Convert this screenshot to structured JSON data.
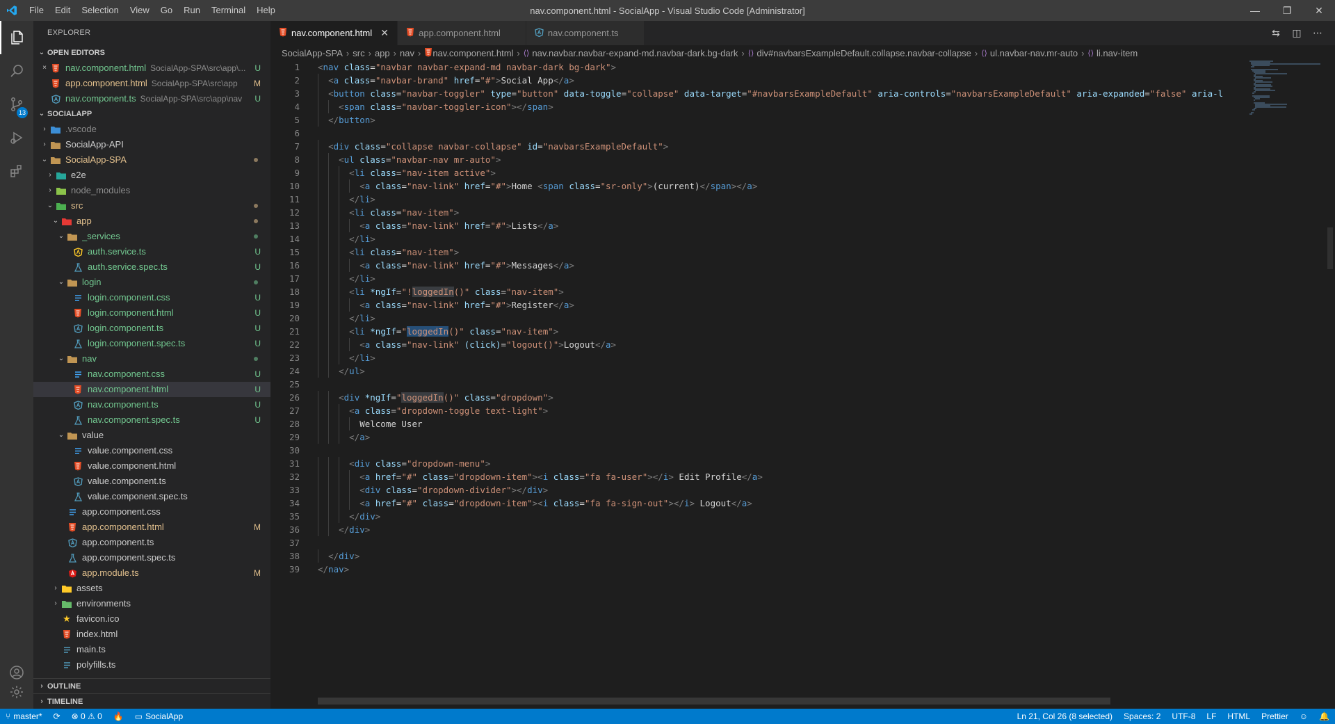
{
  "window": {
    "title": "nav.component.html - SocialApp - Visual Studio Code [Administrator]",
    "menu": [
      "File",
      "Edit",
      "Selection",
      "View",
      "Go",
      "Run",
      "Terminal",
      "Help"
    ],
    "controls": {
      "minimize": "—",
      "restore": "❐",
      "close": "✕"
    }
  },
  "activity_bar": {
    "items": [
      {
        "name": "explorer-icon",
        "glyph": "❐"
      },
      {
        "name": "search-icon",
        "glyph": "⌕"
      },
      {
        "name": "source-control-icon",
        "glyph": "⑂",
        "badge": "13"
      },
      {
        "name": "run-debug-icon",
        "glyph": "▷"
      },
      {
        "name": "extensions-icon",
        "glyph": "⊞"
      }
    ],
    "bottom": [
      {
        "name": "accounts-icon",
        "glyph": "◯"
      },
      {
        "name": "manage-gear-icon",
        "glyph": "⚙"
      }
    ]
  },
  "sidebar": {
    "title": "EXPLORER",
    "open_editors": {
      "heading": "OPEN EDITORS",
      "items": [
        {
          "close": "×",
          "icon": "html",
          "name": "nav.component.html",
          "path": "SocialApp-SPA\\src\\app\\...",
          "status": "U",
          "status_class": "c-untracked"
        },
        {
          "close": "",
          "icon": "html",
          "name": "app.component.html",
          "path": "SocialApp-SPA\\src\\app",
          "status": "M",
          "status_class": "c-modified"
        },
        {
          "close": "",
          "icon": "ts",
          "name": "nav.component.ts",
          "path": "SocialApp-SPA\\src\\app\\nav",
          "status": "U",
          "status_class": "c-untracked"
        }
      ]
    },
    "workspace": {
      "heading": "SOCIALAPP",
      "items": [
        {
          "depth": 0,
          "twist": "›",
          "icon": "folder-vscode",
          "name": ".vscode",
          "cls": "c-ignored",
          "deco": ""
        },
        {
          "depth": 0,
          "twist": "›",
          "icon": "folder",
          "name": "SocialApp-API",
          "cls": "",
          "deco": ""
        },
        {
          "depth": 0,
          "twist": "⌄",
          "icon": "folder",
          "name": "SocialApp-SPA",
          "cls": "c-modified",
          "deco": "dot-modified"
        },
        {
          "depth": 1,
          "twist": "›",
          "icon": "folder-e2e",
          "name": "e2e",
          "cls": "",
          "deco": ""
        },
        {
          "depth": 1,
          "twist": "›",
          "icon": "folder-node",
          "name": "node_modules",
          "cls": "c-ignored",
          "deco": ""
        },
        {
          "depth": 1,
          "twist": "⌄",
          "icon": "folder-src",
          "name": "src",
          "cls": "c-modified",
          "deco": "dot-modified"
        },
        {
          "depth": 2,
          "twist": "⌄",
          "icon": "folder-app",
          "name": "app",
          "cls": "c-modified",
          "deco": "dot-modified"
        },
        {
          "depth": 3,
          "twist": "⌄",
          "icon": "folder",
          "name": "_services",
          "cls": "c-untracked",
          "deco": "dot-untracked"
        },
        {
          "depth": 4,
          "twist": "",
          "icon": "ts-service",
          "name": "auth.service.ts",
          "cls": "c-untracked",
          "deco": "U"
        },
        {
          "depth": 4,
          "twist": "",
          "icon": "spec",
          "name": "auth.service.spec.ts",
          "cls": "c-untracked",
          "deco": "U"
        },
        {
          "depth": 3,
          "twist": "⌄",
          "icon": "folder",
          "name": "login",
          "cls": "c-untracked",
          "deco": "dot-untracked"
        },
        {
          "depth": 4,
          "twist": "",
          "icon": "css",
          "name": "login.component.css",
          "cls": "c-untracked",
          "deco": "U"
        },
        {
          "depth": 4,
          "twist": "",
          "icon": "html",
          "name": "login.component.html",
          "cls": "c-untracked",
          "deco": "U"
        },
        {
          "depth": 4,
          "twist": "",
          "icon": "ts",
          "name": "login.component.ts",
          "cls": "c-untracked",
          "deco": "U"
        },
        {
          "depth": 4,
          "twist": "",
          "icon": "spec",
          "name": "login.component.spec.ts",
          "cls": "c-untracked",
          "deco": "U"
        },
        {
          "depth": 3,
          "twist": "⌄",
          "icon": "folder",
          "name": "nav",
          "cls": "c-untracked",
          "deco": "dot-untracked"
        },
        {
          "depth": 4,
          "twist": "",
          "icon": "css",
          "name": "nav.component.css",
          "cls": "c-untracked",
          "deco": "U"
        },
        {
          "depth": 4,
          "twist": "",
          "icon": "html",
          "name": "nav.component.html",
          "cls": "c-untracked",
          "deco": "U",
          "selected": true
        },
        {
          "depth": 4,
          "twist": "",
          "icon": "ts",
          "name": "nav.component.ts",
          "cls": "c-untracked",
          "deco": "U"
        },
        {
          "depth": 4,
          "twist": "",
          "icon": "spec",
          "name": "nav.component.spec.ts",
          "cls": "c-untracked",
          "deco": "U"
        },
        {
          "depth": 3,
          "twist": "⌄",
          "icon": "folder",
          "name": "value",
          "cls": "",
          "deco": ""
        },
        {
          "depth": 4,
          "twist": "",
          "icon": "css",
          "name": "value.component.css",
          "cls": "",
          "deco": ""
        },
        {
          "depth": 4,
          "twist": "",
          "icon": "html",
          "name": "value.component.html",
          "cls": "",
          "deco": ""
        },
        {
          "depth": 4,
          "twist": "",
          "icon": "ts",
          "name": "value.component.ts",
          "cls": "",
          "deco": ""
        },
        {
          "depth": 4,
          "twist": "",
          "icon": "spec",
          "name": "value.component.spec.ts",
          "cls": "",
          "deco": ""
        },
        {
          "depth": 3,
          "twist": "",
          "icon": "css",
          "name": "app.component.css",
          "cls": "",
          "deco": ""
        },
        {
          "depth": 3,
          "twist": "",
          "icon": "html",
          "name": "app.component.html",
          "cls": "c-modified",
          "deco": "M"
        },
        {
          "depth": 3,
          "twist": "",
          "icon": "ts",
          "name": "app.component.ts",
          "cls": "",
          "deco": ""
        },
        {
          "depth": 3,
          "twist": "",
          "icon": "spec",
          "name": "app.component.spec.ts",
          "cls": "",
          "deco": ""
        },
        {
          "depth": 3,
          "twist": "",
          "icon": "module",
          "name": "app.module.ts",
          "cls": "c-modified",
          "deco": "M"
        },
        {
          "depth": 2,
          "twist": "›",
          "icon": "folder-assets",
          "name": "assets",
          "cls": "",
          "deco": ""
        },
        {
          "depth": 2,
          "twist": "›",
          "icon": "folder-env",
          "name": "environments",
          "cls": "",
          "deco": ""
        },
        {
          "depth": 2,
          "twist": "",
          "icon": "favicon",
          "name": "favicon.ico",
          "cls": "",
          "deco": ""
        },
        {
          "depth": 2,
          "twist": "",
          "icon": "html",
          "name": "index.html",
          "cls": "",
          "deco": ""
        },
        {
          "depth": 2,
          "twist": "",
          "icon": "ts-plain",
          "name": "main.ts",
          "cls": "",
          "deco": ""
        },
        {
          "depth": 2,
          "twist": "",
          "icon": "ts-plain",
          "name": "polyfills.ts",
          "cls": "",
          "deco": ""
        }
      ]
    },
    "outline": "OUTLINE",
    "timeline": "TIMELINE"
  },
  "tabs": [
    {
      "icon": "html",
      "label": "nav.component.html",
      "active": true,
      "close": "✕"
    },
    {
      "icon": "html",
      "label": "app.component.html",
      "active": false,
      "close": ""
    },
    {
      "icon": "ts",
      "label": "nav.component.ts",
      "active": false,
      "close": ""
    }
  ],
  "tab_actions": [
    "open-changes-icon",
    "split-editor-icon",
    "more-actions-icon"
  ],
  "breadcrumbs": [
    {
      "text": "SocialApp-SPA",
      "icon": ""
    },
    {
      "text": "src",
      "icon": ""
    },
    {
      "text": "app",
      "icon": ""
    },
    {
      "text": "nav",
      "icon": ""
    },
    {
      "text": "nav.component.html",
      "icon": "html"
    },
    {
      "text": "nav.navbar.navbar-expand-md.navbar-dark.bg-dark",
      "icon": "sym"
    },
    {
      "text": "div#navbarsExampleDefault.collapse.navbar-collapse",
      "icon": "sym"
    },
    {
      "text": "ul.navbar-nav.mr-auto",
      "icon": "sym"
    },
    {
      "text": "li.nav-item",
      "icon": "sym"
    }
  ],
  "code_lines": [
    "<nav class=\"navbar navbar-expand-md navbar-dark bg-dark\">",
    "  <a class=\"navbar-brand\" href=\"#\">Social App</a>",
    "  <button class=\"navbar-toggler\" type=\"button\" data-toggle=\"collapse\" data-target=\"#navbarsExampleDefault\" aria-controls=\"navbarsExampleDefault\" aria-expanded=\"false\" aria-l",
    "    <span class=\"navbar-toggler-icon\"></span>",
    "  </button>",
    "",
    "  <div class=\"collapse navbar-collapse\" id=\"navbarsExampleDefault\">",
    "    <ul class=\"navbar-nav mr-auto\">",
    "      <li class=\"nav-item active\">",
    "        <a class=\"nav-link\" href=\"#\">Home <span class=\"sr-only\">(current)</span></a>",
    "      </li>",
    "      <li class=\"nav-item\">",
    "        <a class=\"nav-link\" href=\"#\">Lists</a>",
    "      </li>",
    "      <li class=\"nav-item\">",
    "        <a class=\"nav-link\" href=\"#\">Messages</a>",
    "      </li>",
    "      <li *ngIf=\"!loggedIn()\" class=\"nav-item\">",
    "        <a class=\"nav-link\" href=\"#\">Register</a>",
    "      </li>",
    "      <li *ngIf=\"loggedIn()\" class=\"nav-item\">",
    "        <a class=\"nav-link\" (click)=\"logout()\">Logout</a>",
    "      </li>",
    "    </ul>",
    "",
    "    <div *ngIf=\"loggedIn()\" class=\"dropdown\">",
    "      <a class=\"dropdown-toggle text-light\">",
    "        Welcome User",
    "      </a>",
    "",
    "      <div class=\"dropdown-menu\">",
    "        <a href=\"#\" class=\"dropdown-item\"><i class=\"fa fa-user\"></i> Edit Profile</a>",
    "        <div class=\"dropdown-divider\"></div>",
    "        <a href=\"#\" class=\"dropdown-item\"><i class=\"fa fa-sign-out\"></i> Logout</a>",
    "      </div>",
    "    </div>",
    "",
    "  </div>",
    "</nav>"
  ],
  "cursor": {
    "line": 21,
    "selected_word": "loggedIn"
  },
  "statusbar": {
    "branch": "master*",
    "sync": "⟳",
    "problems": "⊗ 0 ⚠ 0",
    "live": "🔥",
    "workspace": "SocialApp",
    "position": "Ln 21, Col 26 (8 selected)",
    "spaces": "Spaces: 2",
    "encoding": "UTF-8",
    "eol": "LF",
    "language": "HTML",
    "formatter": "Prettier",
    "feedback": "☺",
    "bell": "🔔"
  },
  "colors": {
    "accent": "#007acc",
    "untracked": "#73c991",
    "modified": "#e2c08d",
    "html_icon": "#e44d26",
    "ts_icon": "#519aba",
    "css_icon": "#42a5f5",
    "angular_icon": "#dd1b16"
  }
}
